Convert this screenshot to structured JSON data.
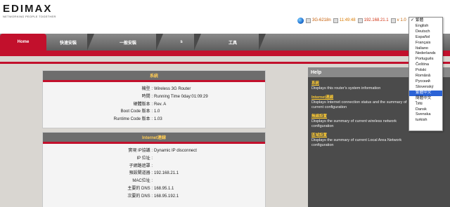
{
  "brand": {
    "logo": "EDIMAX",
    "tagline": "NETWORKING PEOPLE TOGETHER"
  },
  "status": {
    "model": "3G-6218n",
    "uptime": "11:49:48",
    "ip": "192.168.21.1",
    "version": "v 1.0"
  },
  "nav": {
    "tabs": [
      {
        "label": "Home",
        "active": true
      },
      {
        "label": "快速安裝",
        "active": false
      },
      {
        "label": "一般安裝",
        "active": false
      },
      {
        "label": "s",
        "active": false
      },
      {
        "label": "工具",
        "active": false
      }
    ]
  },
  "system_panel": {
    "title": "系統",
    "rows": [
      {
        "label": "機型 :",
        "value": "Wireless 3G Router"
      },
      {
        "label": "時間 :",
        "value": "Running Time 0day:01:09:29"
      },
      {
        "label": "硬體版本 :",
        "value": "Rev. A"
      },
      {
        "label": "Boot Code 版本 :",
        "value": "1.0"
      },
      {
        "label": "Runtime Code 版本 :",
        "value": "1.03"
      }
    ]
  },
  "internet_panel": {
    "title": "Internet連線",
    "rows": [
      {
        "label": "實現 IP協議 :",
        "value": "Dynamic IP disconnect"
      },
      {
        "label": "IP 位址 :",
        "value": ""
      },
      {
        "label": "子網路遮罩 :",
        "value": ""
      },
      {
        "label": "預設閘道器 :",
        "value": "192.168.21.1"
      },
      {
        "label": "MAC位址 :",
        "value": ""
      },
      {
        "label": "主要的 DNS :",
        "value": "168.95.1.1"
      },
      {
        "label": "次要的 DNS :",
        "value": "168.95.192.1"
      }
    ]
  },
  "help": {
    "title": "Help",
    "items": [
      {
        "title": "系統",
        "desc": "Displays this router's system information"
      },
      {
        "title": "Internet連線",
        "desc": "Displays Internet connection status and the summary of current configuration"
      },
      {
        "title": "無線設置",
        "desc": "Displays the summary of current wireless network configuration"
      },
      {
        "title": "區域設置",
        "desc": "Displays the summary of current Local Area Network configuration"
      }
    ]
  },
  "language_menu": {
    "options": [
      {
        "label": "繁體",
        "checked": true,
        "highlighted": false
      },
      {
        "label": "English",
        "checked": false,
        "highlighted": false
      },
      {
        "label": "Deutsch",
        "checked": false,
        "highlighted": false
      },
      {
        "label": "Español",
        "checked": false,
        "highlighted": false
      },
      {
        "label": "Français",
        "checked": false,
        "highlighted": false
      },
      {
        "label": "Italiano",
        "checked": false,
        "highlighted": false
      },
      {
        "label": "Nederlands",
        "checked": false,
        "highlighted": false
      },
      {
        "label": "Português",
        "checked": false,
        "highlighted": false
      },
      {
        "label": "Čeština",
        "checked": false,
        "highlighted": false
      },
      {
        "label": "Polski",
        "checked": false,
        "highlighted": false
      },
      {
        "label": "Română",
        "checked": false,
        "highlighted": false
      },
      {
        "label": "Русский",
        "checked": false,
        "highlighted": false
      },
      {
        "label": "Slovenský",
        "checked": false,
        "highlighted": false
      },
      {
        "label": "繁體中文",
        "checked": false,
        "highlighted": true
      },
      {
        "label": "簡體中文",
        "checked": false,
        "highlighted": false
      },
      {
        "label": "ไทย",
        "checked": false,
        "highlighted": false
      },
      {
        "label": "Dansk",
        "checked": false,
        "highlighted": false
      },
      {
        "label": "Svenska",
        "checked": false,
        "highlighted": false
      },
      {
        "label": "turkish",
        "checked": false,
        "highlighted": false
      }
    ]
  },
  "colors": {
    "accent_red": "#c2102c",
    "help_title": "#ffcc33",
    "panel_title": "#ffcc55",
    "highlight_blue": "#2b63d6"
  }
}
